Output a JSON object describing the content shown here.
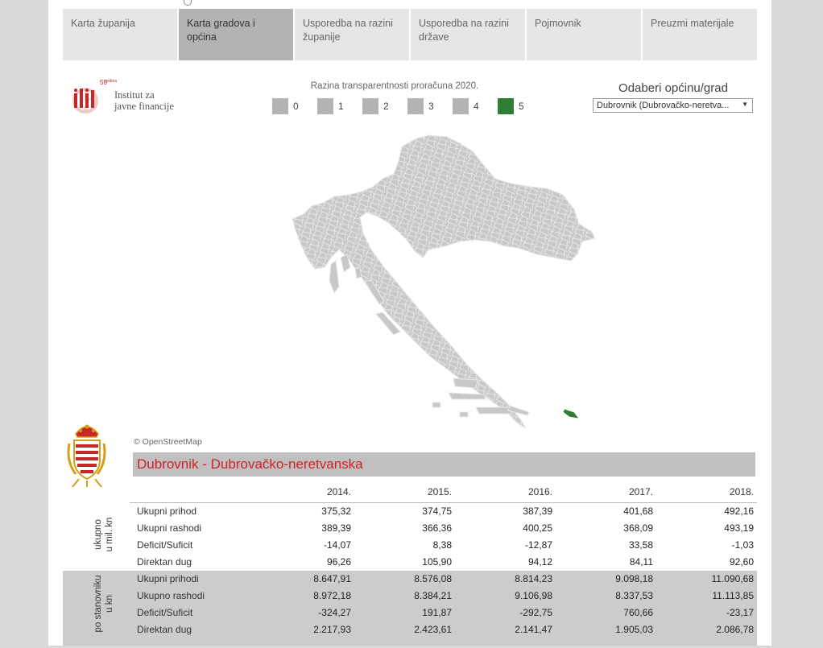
{
  "tabs": [
    {
      "label": "Karta županija",
      "active": false
    },
    {
      "label": "Karta gradova i općina",
      "active": true
    },
    {
      "label": "Usporedba na razini županije",
      "active": false
    },
    {
      "label": "Usporedba na razini države",
      "active": false
    },
    {
      "label": "Pojmovnik",
      "active": false
    },
    {
      "label": "Preuzmi materijale",
      "active": false
    }
  ],
  "logo": {
    "badge_number": "50",
    "badge_small": "godina",
    "line1": "Institut za",
    "line2": "javne financije"
  },
  "legend": {
    "title": "Razina transparentnosti proračuna 2020.",
    "items": [
      {
        "label": "0",
        "color": "#b3b3b3"
      },
      {
        "label": "1",
        "color": "#b3b3b3"
      },
      {
        "label": "2",
        "color": "#b3b3b3"
      },
      {
        "label": "3",
        "color": "#b3b3b3"
      },
      {
        "label": "4",
        "color": "#b3b3b3"
      },
      {
        "label": "5",
        "color": "#2e7d32"
      }
    ]
  },
  "selector": {
    "title": "Odaberi općinu/grad",
    "value": "Dubrovnik (Dubrovačko-neretva..."
  },
  "map": {
    "attribution": "© OpenStreetMap",
    "base_color": "#c8c8c8",
    "highlight_color": "#2e7d32"
  },
  "table": {
    "title": "Dubrovnik - Dubrovačko-neretvanska",
    "years": [
      "2014.",
      "2015.",
      "2016.",
      "2017.",
      "2018."
    ],
    "groups": [
      {
        "label_line1": "ukupno",
        "label_line2": "u mil. kn",
        "rows": [
          {
            "label": "Ukupni prihod",
            "values": [
              "375,32",
              "374,75",
              "387,39",
              "401,68",
              "492,16"
            ]
          },
          {
            "label": "Ukupni rashodi",
            "values": [
              "389,39",
              "366,36",
              "400,25",
              "368,09",
              "493,19"
            ]
          },
          {
            "label": "Deficit/Suficit",
            "values": [
              "-14,07",
              "8,38",
              "-12,87",
              "33,58",
              "-1,03"
            ]
          },
          {
            "label": "Direktan dug",
            "values": [
              "96,26",
              "105,90",
              "94,12",
              "84,11",
              "92,60"
            ]
          }
        ]
      },
      {
        "label_line1": "po stanovniku",
        "label_line2": "u kn",
        "rows": [
          {
            "label": "Ukupni prihodi",
            "values": [
              "8.647,91",
              "8.576,08",
              "8.814,23",
              "9.098,18",
              "11.090,68"
            ]
          },
          {
            "label": "Ukupno rashodi",
            "values": [
              "8.972,18",
              "8.384,21",
              "9.106,98",
              "8.337,53",
              "11.113,85"
            ]
          },
          {
            "label": "Deficit/Suficit",
            "values": [
              "-324,27",
              "191,87",
              "-292,75",
              "760,66",
              "-23,17"
            ]
          },
          {
            "label": "Direktan dug",
            "values": [
              "2.217,93",
              "2.423,61",
              "2.141,47",
              "1.905,03",
              "2.086,78"
            ]
          }
        ]
      }
    ]
  }
}
